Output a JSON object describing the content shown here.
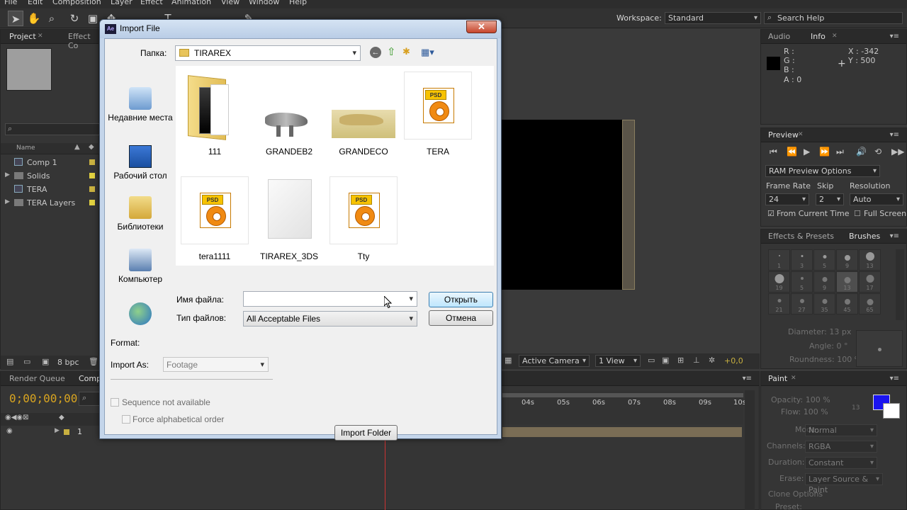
{
  "menubar": [
    "File",
    "Edit",
    "Composition",
    "Layer",
    "Effect",
    "Animation",
    "View",
    "Window",
    "Help"
  ],
  "workspace": {
    "label": "Workspace:",
    "value": "Standard"
  },
  "search_help": {
    "placeholder": "Search Help"
  },
  "project_panel": {
    "tabs": [
      "Project",
      "Effect Co"
    ],
    "column_name": "Name",
    "items": [
      {
        "name": "Comp 1",
        "icon": "composition-icon",
        "color": "#c8b040"
      },
      {
        "name": "Solids",
        "icon": "folder-icon",
        "color": "#e0d040"
      },
      {
        "name": "TERA",
        "icon": "composition-icon",
        "color": "#c8b040"
      },
      {
        "name": "TERA Layers",
        "icon": "folder-icon",
        "color": "#e0d040"
      }
    ],
    "bpc": "8 bpc"
  },
  "timeline": {
    "tabs": [
      "Render Queue",
      "Comp"
    ],
    "timecode": "0;00;00;00",
    "layer_number": "1",
    "ruler_marks": [
      "04s",
      "05s",
      "06s",
      "07s",
      "08s",
      "09s",
      "10s"
    ]
  },
  "viewer": {
    "camera": "Active Camera",
    "views": "1 View",
    "offset": "+0,0"
  },
  "info_panel": {
    "tabs": [
      "Audio",
      "Info"
    ],
    "r": "R :",
    "g": "G :",
    "b": "B :",
    "a": "A : 0",
    "x": "X : -342",
    "y": "Y : 500"
  },
  "preview_panel": {
    "tab": "Preview",
    "ram_preview": "RAM Preview Options",
    "frame_rate_label": "Frame Rate",
    "frame_rate": "24",
    "skip_label": "Skip",
    "skip": "2",
    "resolution_label": "Resolution",
    "resolution": "Auto",
    "from_current_time": "From Current Time",
    "full_screen": "Full Screen"
  },
  "brushes_panel": {
    "tabs": [
      "Effects & Presets",
      "Brushes"
    ],
    "sizes": [
      "1",
      "3",
      "5",
      "9",
      "13",
      "19",
      "5",
      "9",
      "13",
      "17",
      "21",
      "27",
      "35",
      "45",
      "65"
    ],
    "diameter": "Diameter: 13 px",
    "angle": "Angle: 0 °",
    "roundness": "Roundness: 100 %"
  },
  "paint_panel": {
    "tab": "Paint",
    "opacity": "Opacity: 100 %",
    "flow": "Flow: 100 %",
    "size": "13",
    "mode_label": "Mode:",
    "mode": "Normal",
    "channels_label": "Channels:",
    "channels": "RGBA",
    "duration_label": "Duration:",
    "duration": "Constant",
    "erase_label": "Erase:",
    "erase": "Layer Source & Paint",
    "clone_options": "Clone Options",
    "preset": "Preset:",
    "fg_color": "#1a14f0",
    "bg_color": "#ffffff"
  },
  "dialog": {
    "title": "Import File",
    "look_in_label": "Папка:",
    "look_in": "TIRAREX",
    "places": [
      "Недавние места",
      "Рабочий стол",
      "Библиотеки",
      "Компьютер",
      ""
    ],
    "files": [
      {
        "name": "111",
        "type": "folder"
      },
      {
        "name": "GRANDEB2",
        "type": "image"
      },
      {
        "name": "GRANDECO",
        "type": "image"
      },
      {
        "name": "TERA",
        "type": "psd"
      },
      {
        "name": "tera1111",
        "type": "psd"
      },
      {
        "name": "TIRAREX_3DS",
        "type": "file"
      },
      {
        "name": "Tty",
        "type": "psd"
      }
    ],
    "filename_label": "Имя файла:",
    "filename": "",
    "filetype_label": "Тип файлов:",
    "filetype": "All Acceptable Files",
    "open_button": "Открыть",
    "cancel_button": "Отмена",
    "format_label": "Format:",
    "import_as_label": "Import As:",
    "import_as": "Footage",
    "sequence": "Sequence not available",
    "force_alpha": "Force alphabetical order",
    "import_folder": "Import Folder"
  }
}
